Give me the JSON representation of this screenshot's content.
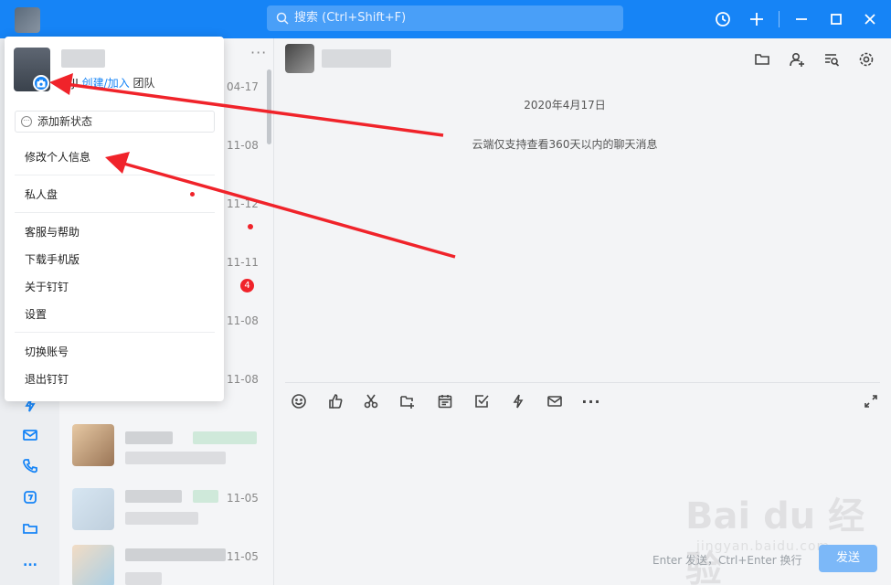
{
  "titlebar": {
    "search_placeholder": "搜索 (Ctrl+Shift+F)",
    "icons": [
      "history-icon",
      "add-icon",
      "minimize-icon",
      "maximize-icon",
      "close-icon"
    ]
  },
  "leftnav": {
    "icons": [
      "lightning-icon",
      "mail-icon",
      "phone-icon",
      "ding-icon",
      "folder-icon",
      "more-icon"
    ],
    "more_label": "..."
  },
  "conversations": {
    "more_label": "···",
    "items": [
      {
        "time": "04-17"
      },
      {
        "time": "11-08"
      },
      {
        "time": "11-12"
      },
      {
        "time": "11-11",
        "unread": "4"
      },
      {
        "time": "11-08"
      },
      {
        "time": "11-08"
      },
      {
        "time": ""
      },
      {
        "time": "11-05"
      },
      {
        "time": "11-05"
      }
    ]
  },
  "chat": {
    "date": "2020年4月17日",
    "notice": "云端仅支持查看360天以内的聊天消息",
    "send_hint": "Enter 发送，Ctrl+Enter 换行",
    "send_label": "发送",
    "head_icons": [
      "folder-icon",
      "add-member-icon",
      "search-history-icon",
      "settings-icon"
    ],
    "tool_icons": [
      "emoji-icon",
      "thumbs-up-icon",
      "scissors-icon",
      "folder-add-icon",
      "calendar-icon",
      "checkbox-icon",
      "lightning-icon",
      "mail-icon",
      "more-icon",
      "expand-icon"
    ]
  },
  "watermark": {
    "brand": "Bai du 经验",
    "url": "jingyan.baidu.com"
  },
  "popup": {
    "org_prefix": "ZIJI",
    "org_link": "创建/加入",
    "org_suffix": "团队",
    "status_label": "添加新状态",
    "menu": {
      "edit_profile": "修改个人信息",
      "private_disk": "私人盘",
      "support": "客服与帮助",
      "download_mobile": "下载手机版",
      "about": "关于钉钉",
      "settings": "设置",
      "switch_account": "切换账号",
      "logout": "退出钉钉"
    }
  },
  "colors": {
    "brand": "#1684f6",
    "annotation_arrow": "#f0232a"
  }
}
